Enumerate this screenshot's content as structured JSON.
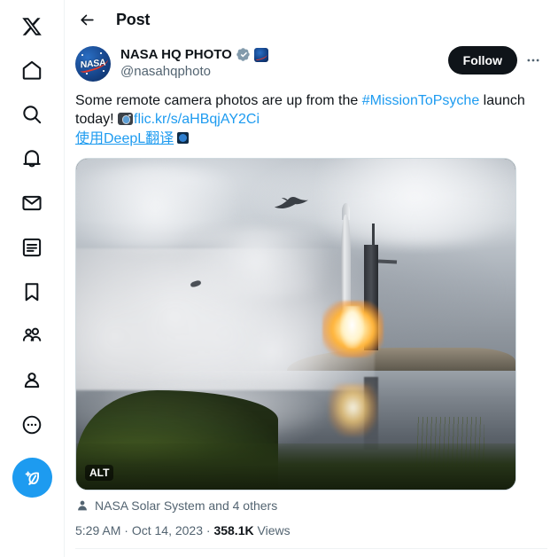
{
  "sidebar": {
    "items": [
      {
        "name": "x-logo",
        "label": "X"
      },
      {
        "name": "home",
        "label": "Home"
      },
      {
        "name": "explore",
        "label": "Explore"
      },
      {
        "name": "notifications",
        "label": "Notifications"
      },
      {
        "name": "messages",
        "label": "Messages"
      },
      {
        "name": "lists",
        "label": "Lists"
      },
      {
        "name": "bookmarks",
        "label": "Bookmarks"
      },
      {
        "name": "communities",
        "label": "Communities"
      },
      {
        "name": "profile",
        "label": "Profile"
      },
      {
        "name": "more",
        "label": "More"
      }
    ],
    "compose_label": "Post",
    "compose_color": "#1d9bf0"
  },
  "topbar": {
    "back_label": "Back",
    "title": "Post"
  },
  "post": {
    "author": {
      "display_name": "NASA HQ PHOTO",
      "handle": "@nasahqphoto",
      "avatar_text": "NASA",
      "verified": true,
      "affiliate_badge": "nasa-affiliate"
    },
    "follow_label": "Follow",
    "more_label": "More",
    "text": {
      "part1": "Some remote camera photos are up from the ",
      "hashtag": "#MissionToPsyche",
      "part2": " launch today! ",
      "url": "flic.kr/s/aHBqjAY2Ci"
    },
    "translate": {
      "label": "使用DeepL翻译",
      "badge": "deepl-badge"
    },
    "media": {
      "alt_badge": "ALT",
      "description": "Rocket launch at dusk reflected in water with a bird flying overhead"
    },
    "social_proof": "NASA Solar System and 4 others",
    "meta": {
      "time": "5:29 AM",
      "separator1": " · ",
      "date": "Oct 14, 2023",
      "separator2": " · ",
      "views_count": "358.1K",
      "views_label": " Views"
    }
  },
  "colors": {
    "accent": "#1d9bf0",
    "text_primary": "#0f1419",
    "text_secondary": "#536471",
    "border": "#eff3f4",
    "follow_bg": "#0f1419"
  }
}
